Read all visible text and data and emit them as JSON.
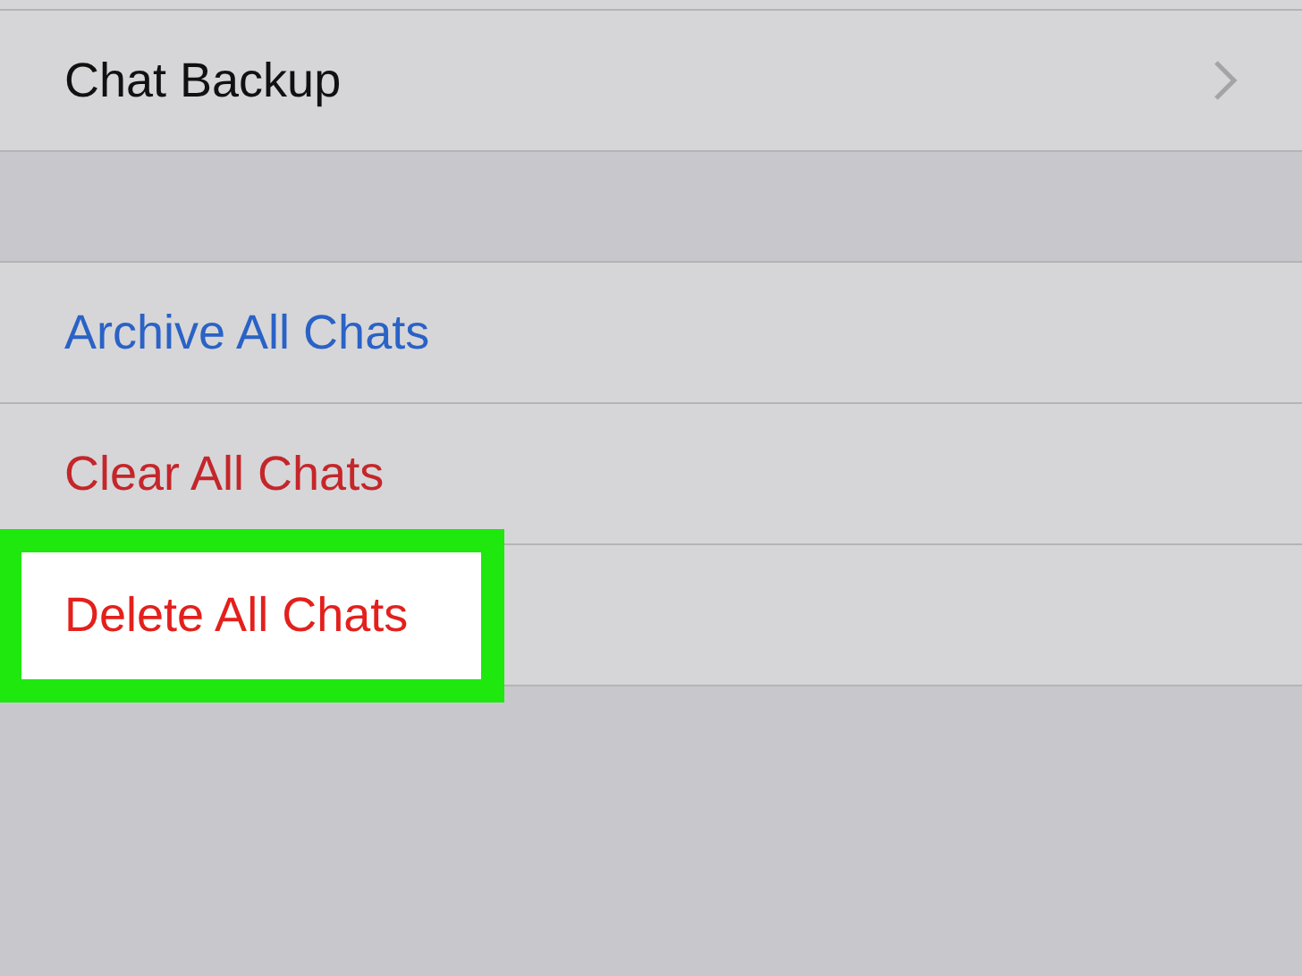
{
  "sections": [
    {
      "rows": [
        {
          "label": "Chat Backup",
          "color": "#111111",
          "chevron": true,
          "highlighted": false
        }
      ]
    },
    {
      "rows": [
        {
          "label": "Archive All Chats",
          "color": "#2a62c6",
          "chevron": false,
          "highlighted": false
        },
        {
          "label": "Clear All Chats",
          "color": "#c4262a",
          "chevron": false,
          "highlighted": false
        },
        {
          "label": "Delete All Chats",
          "color": "#e3201c",
          "chevron": false,
          "highlighted": true
        }
      ]
    }
  ]
}
